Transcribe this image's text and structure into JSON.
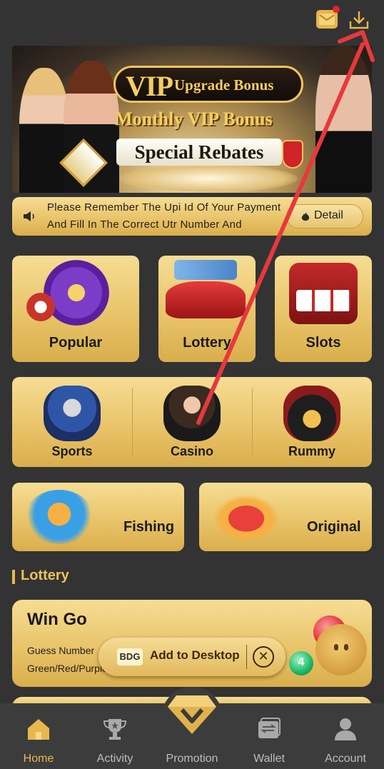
{
  "colors": {
    "background": "#333333",
    "gold_accent": "#e8b84e",
    "card_gold": "#e9c46a",
    "nav_bg": "#3c3c3c",
    "arrow_red": "#e8383d",
    "notification_dot": "#e0272f"
  },
  "header": {
    "mail_icon": "mail-icon",
    "download_icon": "download-icon"
  },
  "banner": {
    "vip": "VIP",
    "line1": "Upgrade Bonus",
    "line2": "Monthly VIP Bonus",
    "line3": "Special Rebates"
  },
  "notice": {
    "text": "Please Remember The Upi Id Of Your Payment And Fill In The Correct Utr Number And",
    "detail_label": "Detail"
  },
  "categories": {
    "popular": "Popular",
    "lottery": "Lottery",
    "slots": "Slots",
    "sports": "Sports",
    "casino": "Casino",
    "rummy": "Rummy",
    "fishing": "Fishing",
    "original": "Original"
  },
  "lottery_section": {
    "title": "Lottery",
    "wingo_title": "Win Go",
    "wingo_desc": "Guess Number Green/Red/Purple",
    "ball_number": "4"
  },
  "add_to_desktop": {
    "logo": "BDG",
    "label": "Add to Desktop"
  },
  "nav": {
    "home": "Home",
    "activity": "Activity",
    "promotion": "Promotion",
    "wallet": "Wallet",
    "account": "Account"
  }
}
